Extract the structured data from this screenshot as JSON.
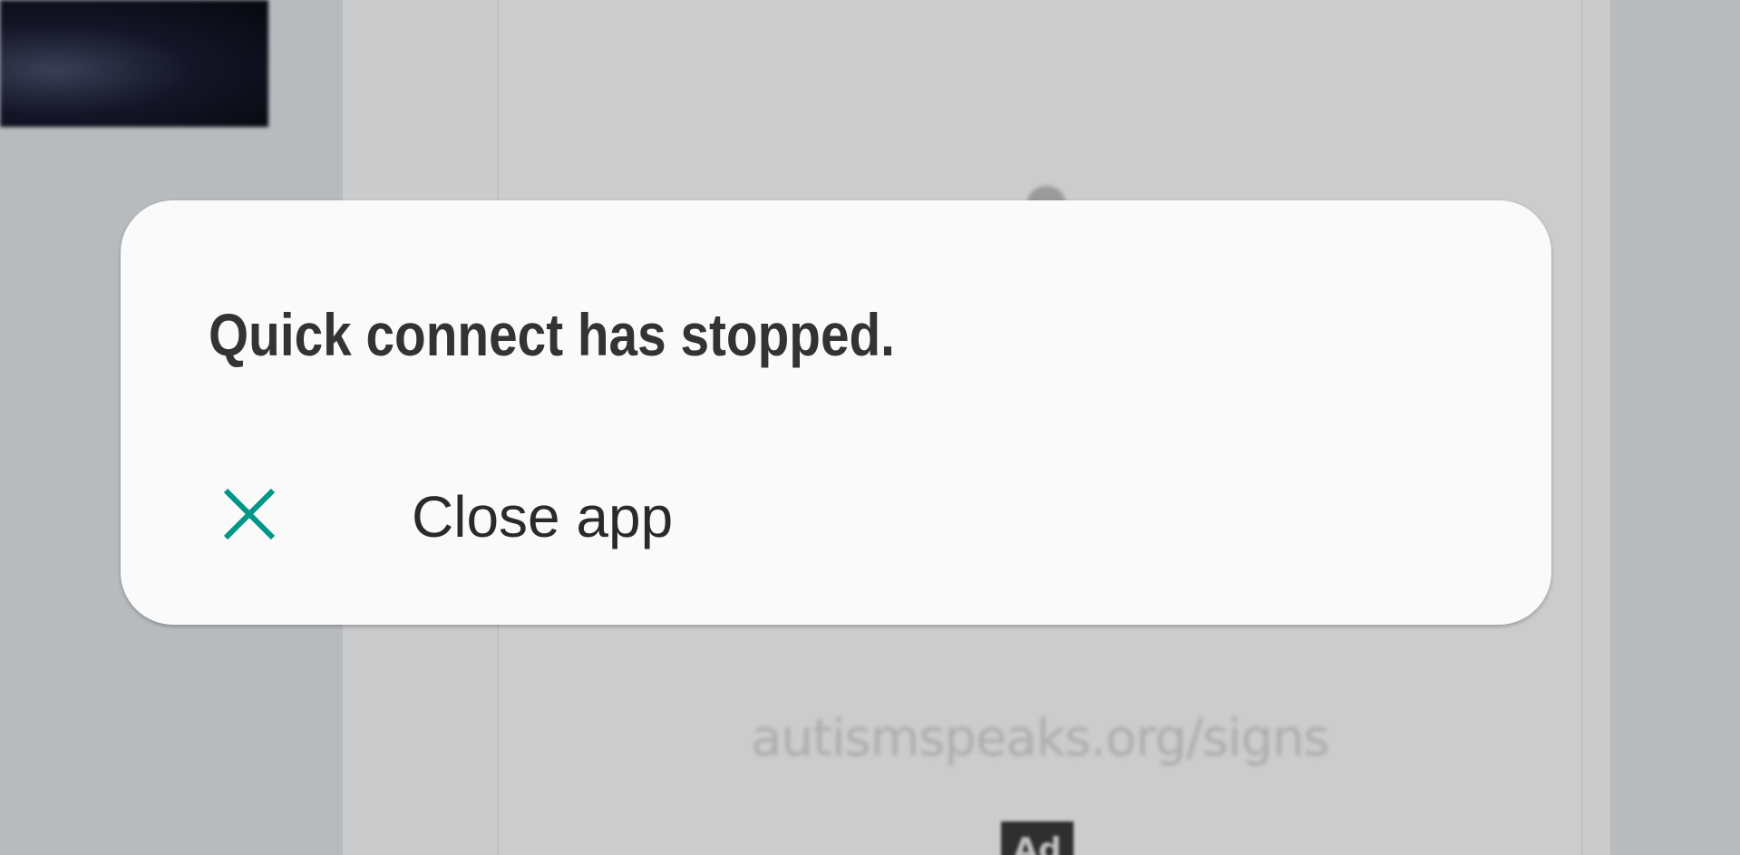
{
  "background": {
    "url_text": "autismspeaks.org/signs",
    "ad_badge": "Ad"
  },
  "dialog": {
    "title": "Quick connect has stopped.",
    "actions": [
      {
        "label": "Close app",
        "icon": "close-icon",
        "icon_color": "#009688"
      }
    ]
  },
  "colors": {
    "dialog_bg": "#fafafa",
    "accent": "#009688",
    "title_text": "#333333"
  }
}
